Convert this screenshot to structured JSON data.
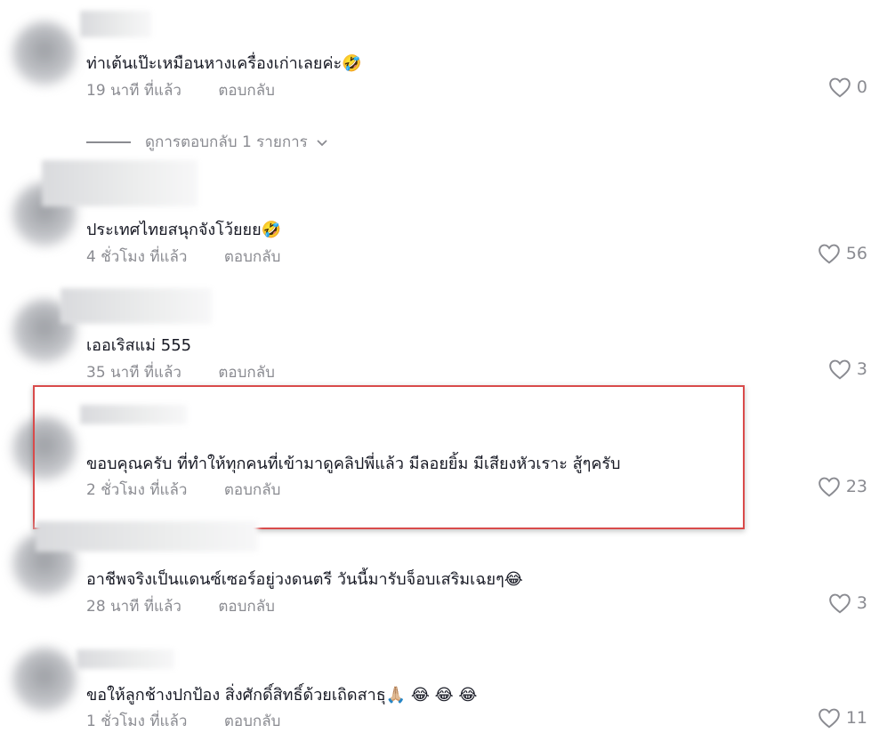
{
  "comments": [
    {
      "text": "ท่าเต้นเป๊ะเหมือนหางเครื่องเก่าเลยค่ะ",
      "emoji": "🤣",
      "time": "19 นาที ที่แล้ว",
      "reply": "ตอบกลับ",
      "likes": "0"
    },
    {
      "text": "ประเทศไทยสนุกจังโว้ยยย",
      "emoji": "🤣",
      "time": "4 ชั่วโมง ที่แล้ว",
      "reply": "ตอบกลับ",
      "likes": "56"
    },
    {
      "text": "เออเริสแม่ 555",
      "emoji": "",
      "time": "35 นาที ที่แล้ว",
      "reply": "ตอบกลับ",
      "likes": "3"
    },
    {
      "text": "ขอบคุณครับ ที่ทำให้ทุกคนที่เข้ามาดูคลิปพี่แล้ว มีลอยยิ้ม มีเสียงหัวเราะ สู้ๆครับ",
      "emoji": "",
      "time": "2 ชั่วโมง ที่แล้ว",
      "reply": "ตอบกลับ",
      "likes": "23"
    },
    {
      "text": "อาชีพจริงเป็นแดนซ์เซอร์อยู่วงดนตรี วันนี้มารับจ็อบเสริมเฉยๆ",
      "emoji": "😂",
      "time": "28 นาที ที่แล้ว",
      "reply": "ตอบกลับ",
      "likes": "3"
    },
    {
      "text": "ขอให้ลูกช้างปกป้อง สิ่งศักดิ์สิทธิ์ด้วยเถิดสาธุ",
      "emoji": "🙏🏼 😂 😂 😂",
      "time": "1 ชั่วโมง ที่แล้ว",
      "reply": "ตอบกลับ",
      "likes": "11"
    }
  ],
  "view_replies": "ดูการตอบกลับ 1 รายการ",
  "colors": {
    "highlight": "#d94b4b",
    "muted": "#8a8b91",
    "text": "#161823"
  }
}
